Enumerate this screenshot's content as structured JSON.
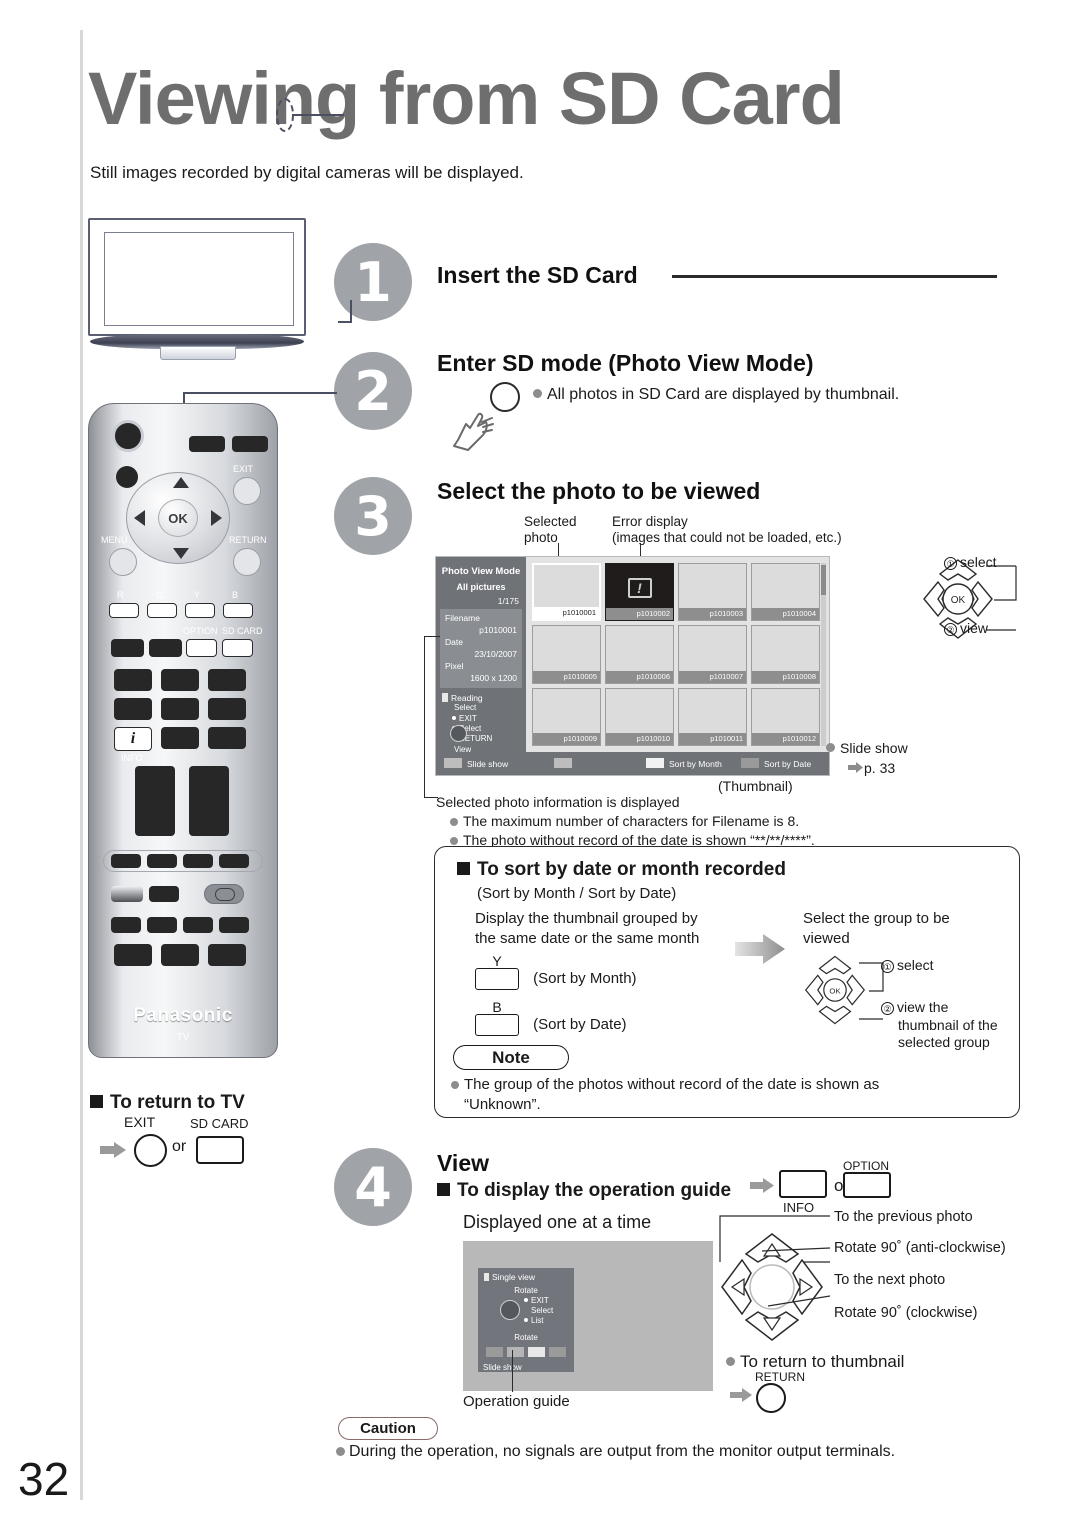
{
  "page": {
    "title": "Viewing from SD Card",
    "subtitle": "Still images recorded by digital cameras will be displayed.",
    "page_number": "32"
  },
  "steps": [
    {
      "number": "1",
      "heading": "Insert the SD Card"
    },
    {
      "number": "2",
      "heading": "Enter SD mode (Photo View Mode)",
      "bullet": "All photos in SD Card are displayed by thumbnail."
    },
    {
      "number": "3",
      "heading": "Select the photo to be viewed"
    },
    {
      "number": "4",
      "heading": "View"
    }
  ],
  "annotations": {
    "selected_photo": "Selected\nphoto",
    "selected_photo_l1": "Selected",
    "selected_photo_l2": "photo",
    "error_display_l1": "Error display",
    "error_display_l2": "(images that could not be loaded, etc.)",
    "thumbnail_caption": "(Thumbnail)",
    "selected_info": "Selected photo information is displayed",
    "note_filename": "The maximum number of characters for Filename is 8.",
    "note_nodate": "The photo without record of the date is shown “**/**/****”.",
    "slide_show": "Slide show",
    "slide_show_page": "p. 33",
    "select_1": "select",
    "view_2": "view",
    "num1": "①",
    "num2": "②"
  },
  "thumbnail_screen": {
    "mode_title": "Photo View Mode",
    "mode_sub": "All pictures",
    "count": "1/175",
    "info": {
      "filename_label": "Filename",
      "filename_value": "p1010001",
      "date_label": "Date",
      "date_value": "23/10/2007",
      "pixel_label": "Pixel",
      "pixel_value": "1600 x 1200"
    },
    "reading": "Reading",
    "keys": {
      "top_label": "Select",
      "exit": "EXIT",
      "select": "Select",
      "return": "RETURN",
      "bottom_label": "View"
    },
    "thumbs": [
      "p1010001",
      "p1010002",
      "p1010003",
      "p1010004",
      "p1010005",
      "p1010006",
      "p1010007",
      "p1010008",
      "p1010009",
      "p1010010",
      "p1010011",
      "p1010012"
    ],
    "selected_index": 0,
    "error_index": 1,
    "bottom_bar": [
      {
        "label": "Slide show",
        "color": "#bdbdbd"
      },
      {
        "label": "",
        "color": "#bdbdbd"
      },
      {
        "label": "Sort by Month",
        "color": "#f2f2f2"
      },
      {
        "label": "Sort by Date",
        "color": "#9a9a9a"
      }
    ]
  },
  "sort_box": {
    "heading": "To sort by date or month recorded",
    "subheading": "(Sort by Month / Sort by Date)",
    "left_text_l1": "Display the thumbnail grouped by",
    "left_text_l2": "the same date or the same month",
    "keys": [
      {
        "key": "Y",
        "label": "(Sort by Month)"
      },
      {
        "key": "B",
        "label": "(Sort by Date)"
      }
    ],
    "right_text_l1": "Select the group to be",
    "right_text_l2": "viewed",
    "right_steps": [
      {
        "num": "①",
        "text": "select"
      },
      {
        "num": "②",
        "text": "view the"
      }
    ],
    "right_step2_cont_l1": "thumbnail of the",
    "right_step2_cont_l2": "selected group",
    "note_badge": "Note",
    "note_text_l1": "The group of the photos without record of the date is shown as",
    "note_text_l2": "“Unknown”."
  },
  "step4": {
    "guide_heading": "To display the operation guide",
    "or": "or",
    "key_info": "INFO",
    "key_option": "OPTION",
    "displayed_one": "Displayed one at a time",
    "operation_guide_label": "Operation guide",
    "dpad_labels": [
      "To the previous photo",
      "Rotate 90˚ (anti-clockwise)",
      "To the next photo",
      "Rotate 90˚ (clockwise)"
    ],
    "return_thumbnail": "To return to thumbnail",
    "return_key": "RETURN"
  },
  "single_view_screen": {
    "title": "Single view",
    "rotate_top": "Rotate",
    "rotate_bottom": "Rotate",
    "keys": [
      "EXIT",
      "Select",
      "List"
    ],
    "slide_show": "Slide show",
    "swatches": [
      "#9a9a9a",
      "#b5b5b5",
      "#e8e8e8",
      "#9a9a9a"
    ]
  },
  "return_to_tv": {
    "heading": "To return to TV",
    "exit_label": "EXIT",
    "or": "or",
    "sd_card_label": "SD CARD"
  },
  "caution": {
    "badge": "Caution",
    "text": "During the operation, no signals are output from the monitor output terminals."
  },
  "remote": {
    "brand": "Panasonic",
    "tv_label": "TV",
    "labels": {
      "exit": "EXIT",
      "menu": "MENU",
      "return": "RETURN",
      "ok": "OK",
      "info": "INFO",
      "option": "OPTION",
      "sd_card": "SD CARD",
      "color_r": "R",
      "color_g": "G",
      "color_y": "Y",
      "color_b": "B",
      "info_glyph": "i"
    }
  },
  "colors": {
    "title_gray": "#6e6e6e",
    "step_circle": "#a0a3a8",
    "screen_side": "#6f7378",
    "bullet_dot": "#8d8d8d"
  }
}
